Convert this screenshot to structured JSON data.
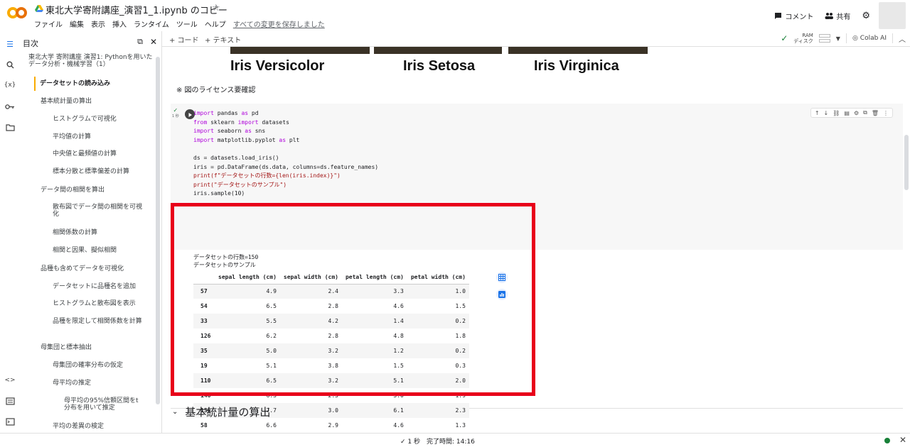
{
  "app": {
    "title": "東北大学寄附講座_演習1_1.ipynb のコピー",
    "menus": [
      "ファイル",
      "編集",
      "表示",
      "挿入",
      "ランタイム",
      "ツール",
      "ヘルプ"
    ],
    "saved_status": "すべての変更を保存しました",
    "comment_label": "コメント",
    "share_label": "共有"
  },
  "toolbar": {
    "add_code": "+ コード",
    "add_text": "+ テキスト",
    "ram_label": "RAM",
    "disk_label": "ディスク",
    "colab_ai": "Colab AI"
  },
  "sidebar": {
    "title": "目次",
    "items": [
      {
        "label": "東北大学 寄附講座 演習1: Pythonを用いたデータ分析・機械学習（1）"
      },
      {
        "label": "データセットの読み込み"
      },
      {
        "label": "基本統計量の算出"
      },
      {
        "label": "ヒストグラムで可視化"
      },
      {
        "label": "平均値の計算"
      },
      {
        "label": "中央値と最頻値の計算"
      },
      {
        "label": "標本分散と標準偏差の計算"
      },
      {
        "label": "データ間の相関を算出"
      },
      {
        "label": "散布図でデータ間の相関を可視化"
      },
      {
        "label": "相関係数の計算"
      },
      {
        "label": "相関と因果、擬似相関"
      },
      {
        "label": "品種も含めてデータを可視化"
      },
      {
        "label": "データセットに品種名を追加"
      },
      {
        "label": "ヒストグラムと散布図を表示"
      },
      {
        "label": "品種を限定して相関係数を計算"
      },
      {
        "label": "母集団と標本抽出"
      },
      {
        "label": "母集団の確率分布の仮定"
      },
      {
        "label": "母平均の推定"
      },
      {
        "label": "母平均の95%信頼区間をt分布を用いて推定"
      },
      {
        "label": "平均の差異の検定"
      }
    ]
  },
  "content": {
    "iris_labels": [
      "Iris Versicolor",
      "Iris Setosa",
      "Iris Virginica"
    ],
    "license_note": "※ 図のライセンス要確認",
    "run_time": "1 秒",
    "code_lines": [
      "import pandas as pd",
      "from sklearn import datasets",
      "import seaborn as sns",
      "import matplotlib.pyplot as plt",
      "",
      "ds = datasets.load_iris()",
      "iris = pd.DataFrame(ds.data, columns=ds.feature_names)",
      "print(f\"データセットの行数={len(iris.index)}\")",
      "print(\"データセットのサンプル\")",
      "iris.sample(10)"
    ],
    "output_lines": [
      "データセットの行数=150",
      "データセットのサンプル"
    ],
    "table": {
      "columns": [
        "",
        "sepal length (cm)",
        "sepal width (cm)",
        "petal length (cm)",
        "petal width (cm)"
      ],
      "rows": [
        [
          "57",
          "4.9",
          "2.4",
          "3.3",
          "1.0"
        ],
        [
          "54",
          "6.5",
          "2.8",
          "4.6",
          "1.5"
        ],
        [
          "33",
          "5.5",
          "4.2",
          "1.4",
          "0.2"
        ],
        [
          "126",
          "6.2",
          "2.8",
          "4.8",
          "1.8"
        ],
        [
          "35",
          "5.0",
          "3.2",
          "1.2",
          "0.2"
        ],
        [
          "19",
          "5.1",
          "3.8",
          "1.5",
          "0.3"
        ],
        [
          "110",
          "6.5",
          "3.2",
          "5.1",
          "2.0"
        ],
        [
          "146",
          "6.3",
          "2.5",
          "5.0",
          "1.9"
        ],
        [
          "135",
          "7.7",
          "3.0",
          "6.1",
          "2.3"
        ],
        [
          "58",
          "6.6",
          "2.9",
          "4.6",
          "1.3"
        ]
      ]
    },
    "next_section": "基本統計量の算出"
  },
  "status": {
    "text": "✓ 1 秒　完了時間: 14:16"
  },
  "colors": {
    "highlight": "#e8001a",
    "active_toc": "#f9ab00",
    "success": "#188038"
  }
}
